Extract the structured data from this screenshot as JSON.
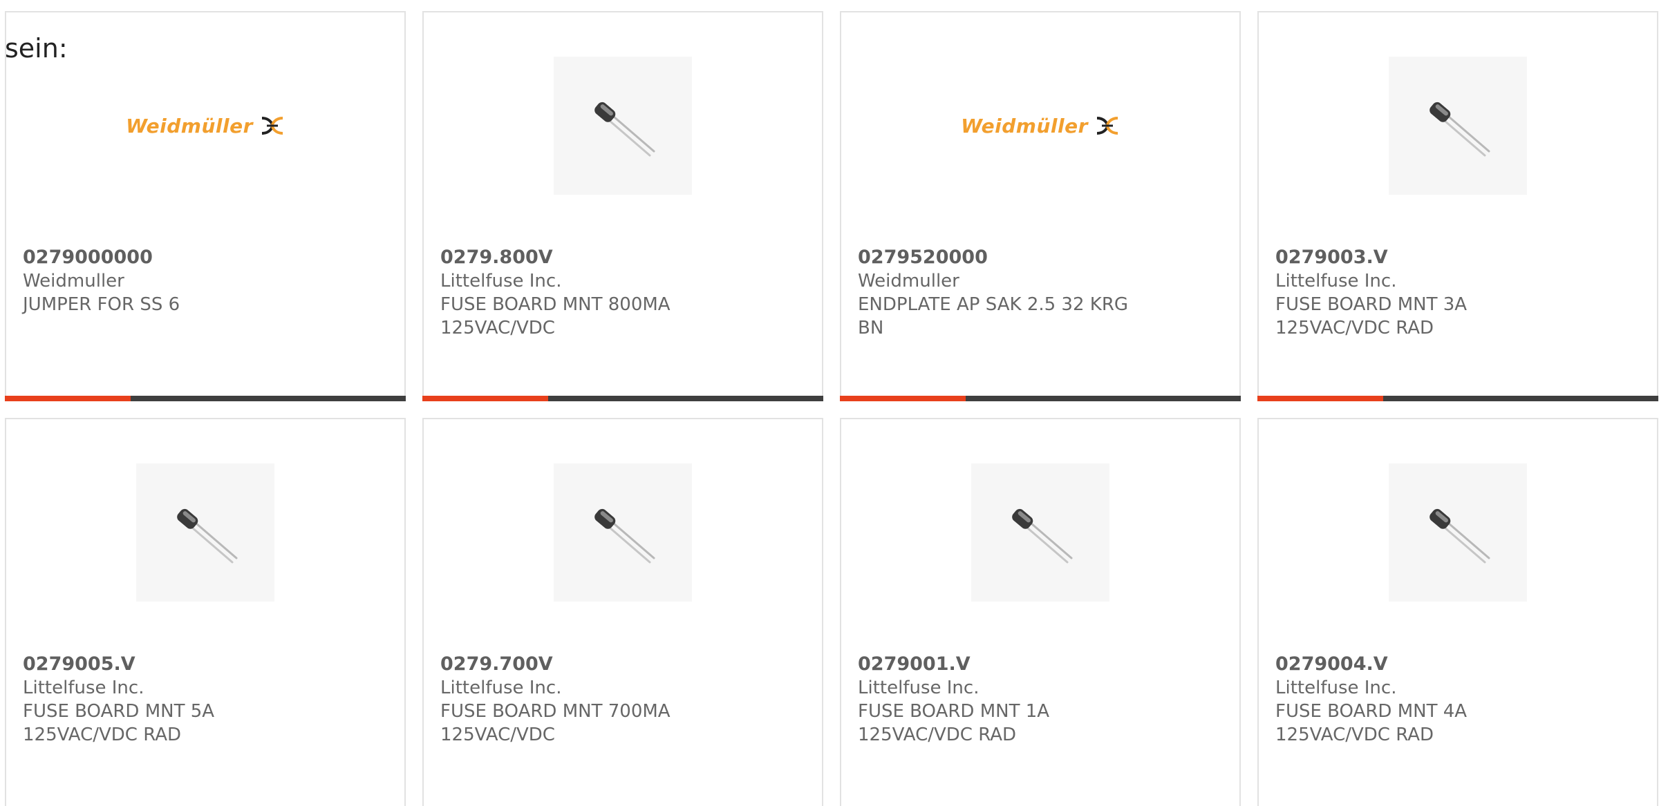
{
  "caption": "sein:",
  "accent_color": "#e8401c",
  "bar_color": "#3f3f3f",
  "logo_text": "Weidmüller",
  "cards": [
    {
      "part": "0279000000",
      "maker": "Weidmuller",
      "desc1": "JUMPER FOR SS 6",
      "desc2": "",
      "image": "weidmuller-logo",
      "bar": true
    },
    {
      "part": "0279.800V",
      "maker": "Littelfuse Inc.",
      "desc1": "FUSE BOARD MNT 800MA",
      "desc2": "125VAC/VDC",
      "image": "fuse-icon",
      "bar": true
    },
    {
      "part": "0279520000",
      "maker": "Weidmuller",
      "desc1": "ENDPLATE AP SAK 2.5 32 KRG",
      "desc2": "BN",
      "image": "weidmuller-logo",
      "bar": true
    },
    {
      "part": "0279003.V",
      "maker": "Littelfuse Inc.",
      "desc1": "FUSE BOARD MNT 3A",
      "desc2": "125VAC/VDC RAD",
      "image": "fuse-icon",
      "bar": true
    },
    {
      "part": "0279005.V",
      "maker": "Littelfuse Inc.",
      "desc1": "FUSE BOARD MNT 5A",
      "desc2": "125VAC/VDC RAD",
      "image": "fuse-icon",
      "bar": false
    },
    {
      "part": "0279.700V",
      "maker": "Littelfuse Inc.",
      "desc1": "FUSE BOARD MNT 700MA",
      "desc2": "125VAC/VDC",
      "image": "fuse-icon",
      "bar": false
    },
    {
      "part": "0279001.V",
      "maker": "Littelfuse Inc.",
      "desc1": "FUSE BOARD MNT 1A",
      "desc2": "125VAC/VDC RAD",
      "image": "fuse-icon",
      "bar": false
    },
    {
      "part": "0279004.V",
      "maker": "Littelfuse Inc.",
      "desc1": "FUSE BOARD MNT 4A",
      "desc2": "125VAC/VDC RAD",
      "image": "fuse-icon",
      "bar": false
    }
  ]
}
